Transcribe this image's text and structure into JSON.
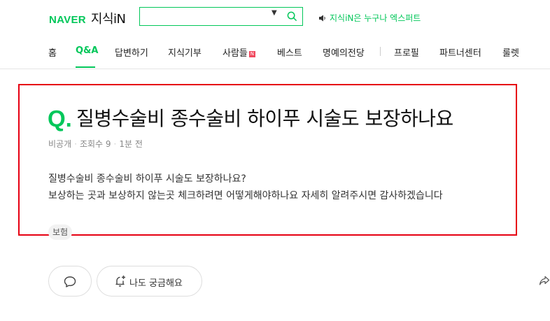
{
  "header": {
    "logo_naver": "NAVER",
    "logo_service": "지식iN",
    "search": {
      "value": "",
      "placeholder": ""
    },
    "promo_text": "지식iN은 누구나 엑스퍼트"
  },
  "nav": {
    "items": [
      {
        "label": "홈"
      },
      {
        "label": "Q&A"
      },
      {
        "label": "답변하기"
      },
      {
        "label": "지식기부"
      },
      {
        "label": "사람들",
        "badge": "N"
      },
      {
        "label": "베스트"
      },
      {
        "label": "명예의전당"
      },
      {
        "label": "프로필"
      },
      {
        "label": "파트너센터"
      },
      {
        "label": "룰렛"
      }
    ]
  },
  "question": {
    "q_mark": "Q.",
    "title": "질병수술비 종수술비 하이푸 시술도 보장하나요",
    "meta": {
      "author": "비공개",
      "views": "조회수 9",
      "time": "1분 전"
    },
    "body_lines": [
      "질병수술비 종수술비 하이푸 시술도 보장하나요?",
      "보상하는 곳과 보상하지 않는곳 체크하려면 어떻게해야하나요 자세히 알려주시면 감사하겠습니다"
    ],
    "tag": "보험"
  },
  "actions": {
    "curious_label": "나도 궁금해요"
  },
  "colors": {
    "brand": "#03c75a",
    "highlight": "#e60012",
    "badge": "#f0495e"
  },
  "icons": [
    "search-icon",
    "dropdown-caret-icon",
    "speaker-icon",
    "comment-icon",
    "bell-plus-icon",
    "share-icon"
  ]
}
